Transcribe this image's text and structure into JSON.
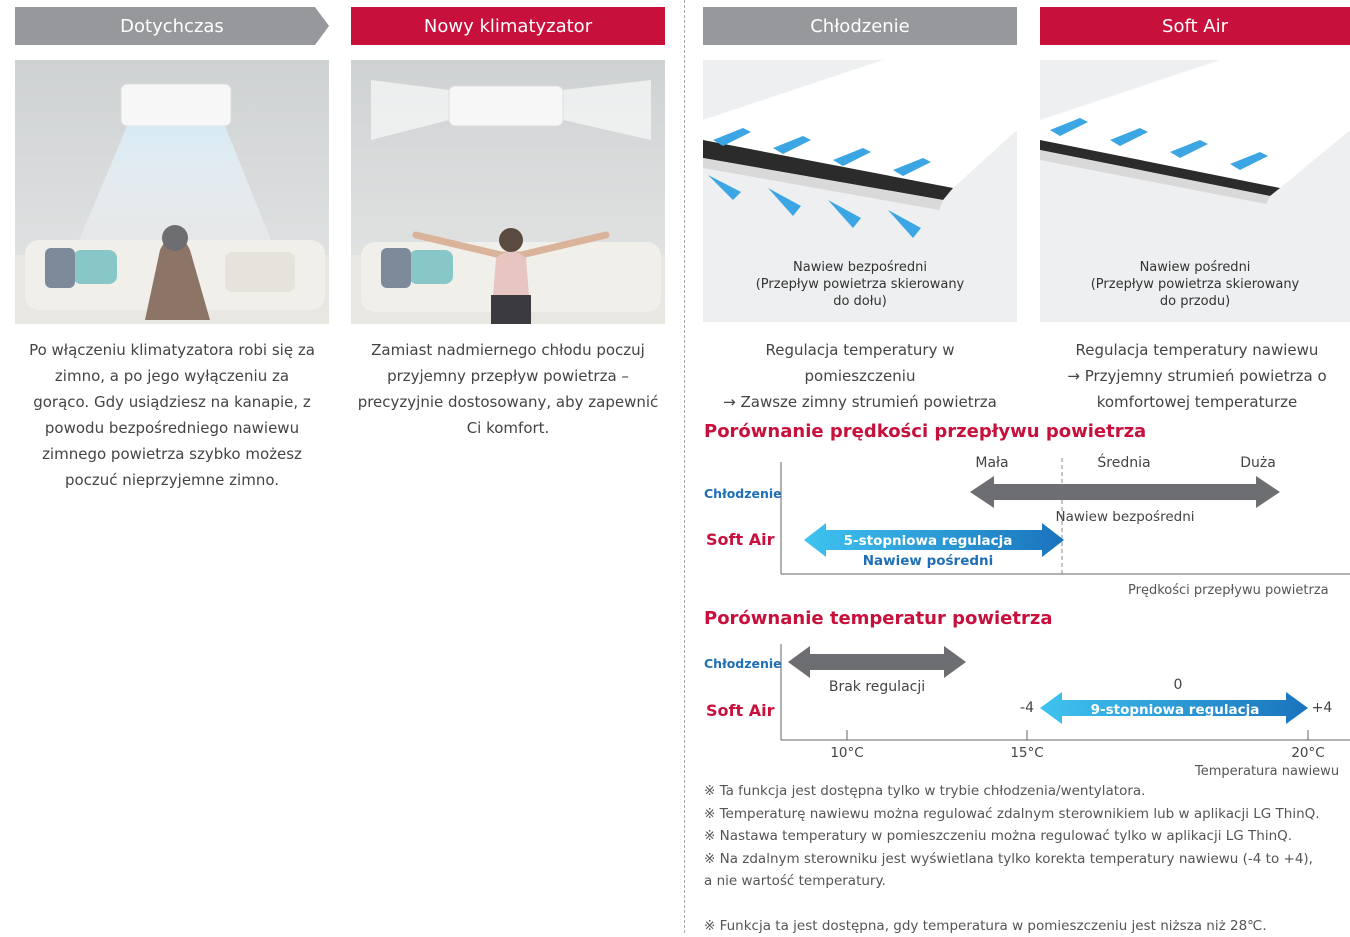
{
  "left": {
    "before": {
      "header": "Dotychczas",
      "description": "Po włączeniu klimatyzatora robi się za zimno, a po jego wyłączeniu za gorąco. Gdy usiądziesz na kanapie, z powodu bezpośredniego nawiewu zimnego powietrza szybko możesz poczuć nieprzyjemne zimno."
    },
    "after": {
      "header": "Nowy klimatyzator",
      "description": "Zamiast nadmiernego chłodu poczuj przyjemny przepływ powietrza – precyzyjnie dostosowany, aby zapewnić Ci komfort."
    }
  },
  "right": {
    "cooling": {
      "header": "Chłodzenie",
      "caption_line1": "Nawiew bezpośredni",
      "caption_line2": "(Przepływ powietrza skierowany",
      "caption_line3": "do dołu)",
      "desc_line1": "Regulacja temperatury w",
      "desc_line2": "pomieszczeniu",
      "desc_line3": "→ Zawsze zimny strumień powietrza"
    },
    "softair": {
      "header": "Soft Air",
      "caption_line1": "Nawiew pośredni",
      "caption_line2": "(Przepływ powietrza skierowany",
      "caption_line3": "do przodu)",
      "desc_line1": "Regulacja temperatury nawiewu",
      "desc_line2": "→ Przyjemny strumień powietrza o",
      "desc_line3": "komfortowej temperaturze"
    }
  },
  "speed_chart": {
    "title": "Porównanie prędkości przepływu powietrza",
    "row_cooling": "Chłodzenie",
    "row_softair": "Soft Air",
    "level_low": "Mała",
    "level_mid": "Średnia",
    "level_high": "Duża",
    "cooling_label": "Nawiew bezpośredni",
    "softair_label": "5-stopniowa regulacja",
    "softair_sublabel": "Nawiew pośredni",
    "axis_label": "Prędkości przepływu powietrza"
  },
  "temp_chart": {
    "title": "Porównanie temperatur powietrza",
    "row_cooling": "Chłodzenie",
    "row_softair": "Soft Air",
    "cooling_label": "Brak regulacji",
    "softair_label": "9-stopniowa regulacja",
    "minus": "-4",
    "zero": "0",
    "plus": "+4",
    "tick_10": "10°C",
    "tick_15": "15°C",
    "tick_20": "20°C",
    "axis_label": "Temperatura nawiewu"
  },
  "notes": [
    "※ Ta funkcja jest dostępna tylko w trybie chłodzenia/wentylatora.",
    "※ Temperaturę nawiewu można regulować zdalnym sterownikiem lub w aplikacji LG ThinQ.",
    "※ Nastawa temperatury w pomieszczeniu można regulować tylko w aplikacji LG ThinQ.",
    "※ Na zdalnym sterowniku jest wyświetlana tylko korekta temperatury nawiewu (-4 to +4),",
    "a nie wartość temperatury.",
    "",
    "※ Funkcja ta jest dostępna, gdy temperatura w pomieszczeniu jest niższa niż 28℃."
  ],
  "colors": {
    "red": "#c8103c",
    "gray": "#96989b",
    "blue": "#1f6fb5",
    "cyan": "#29b6e8",
    "dark_arrow": "#6d6e71"
  }
}
